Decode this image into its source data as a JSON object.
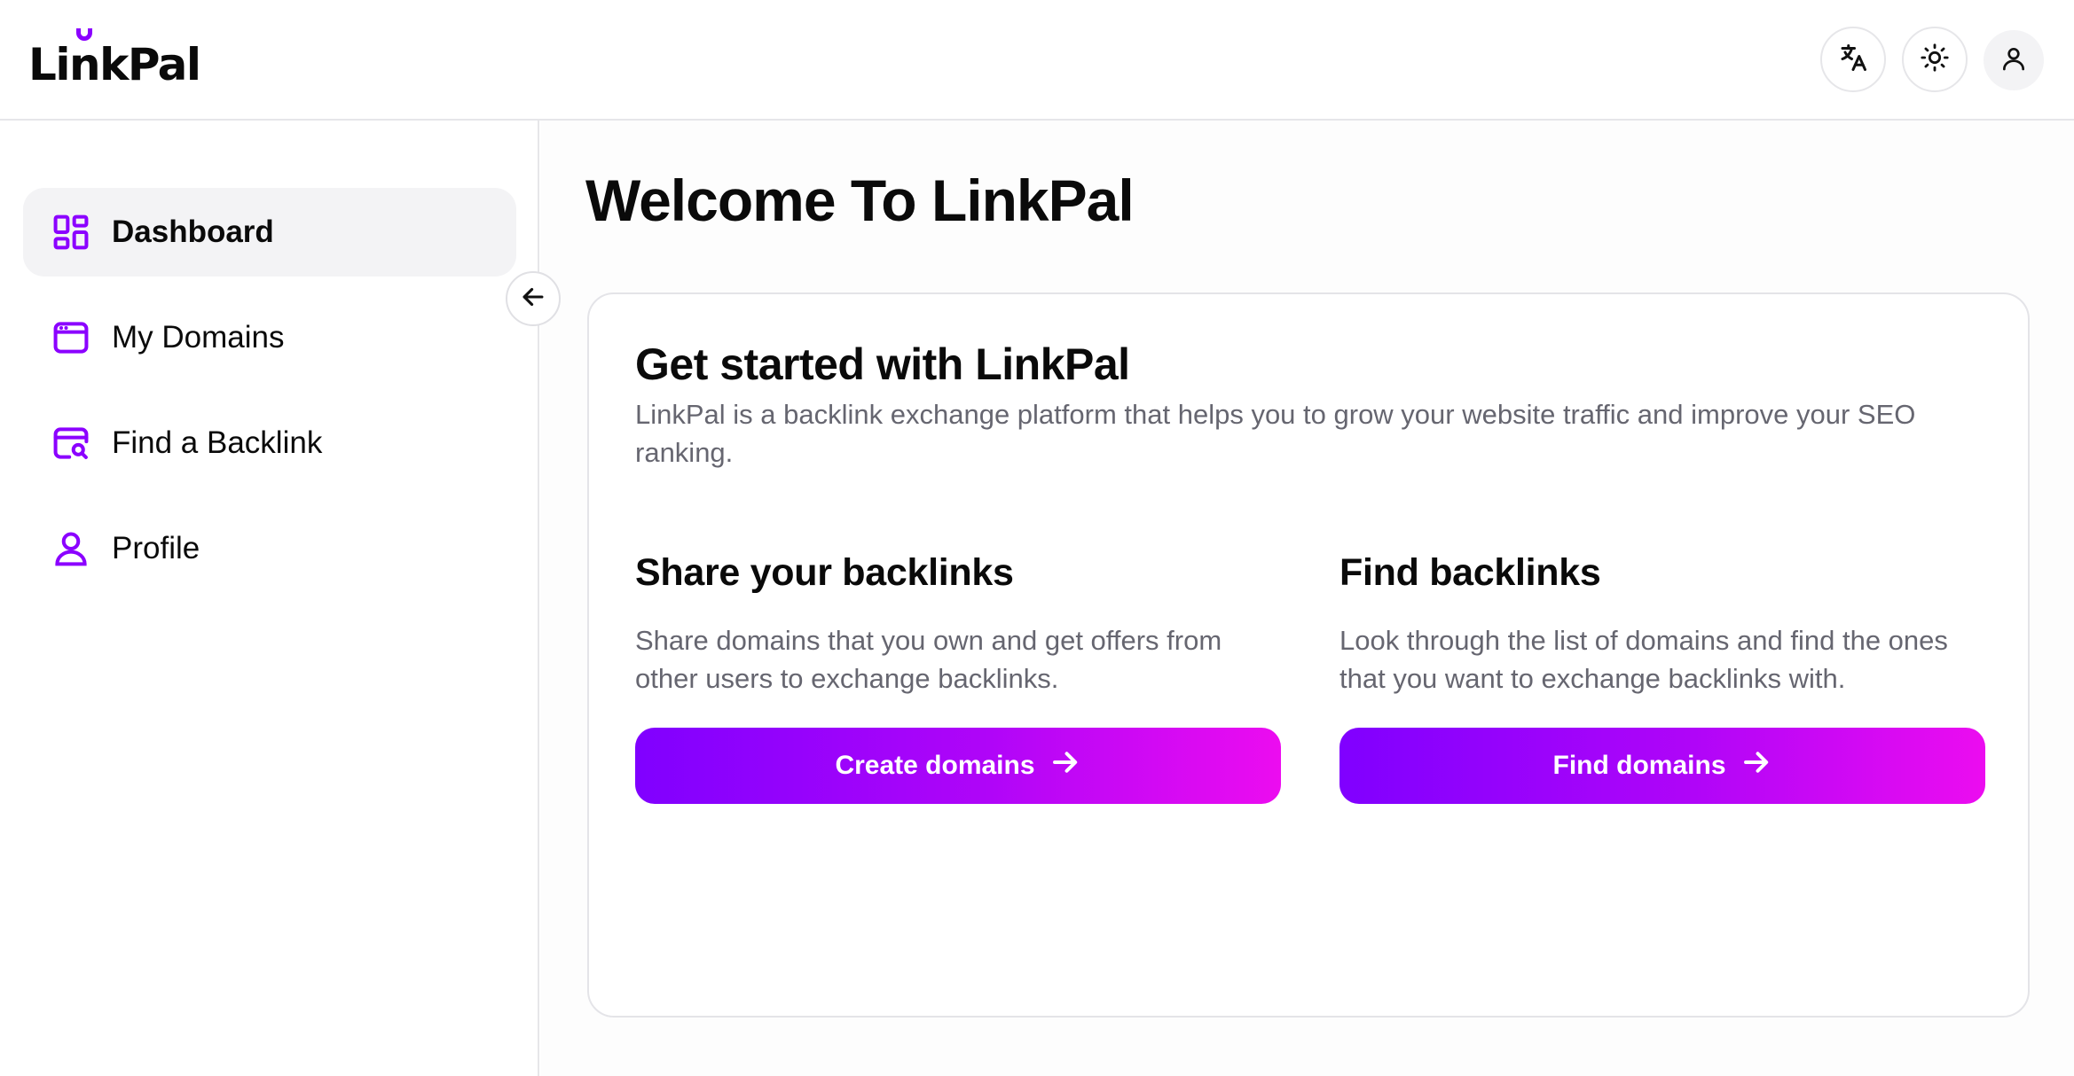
{
  "app": {
    "logo_text_pre": "Li",
    "logo_text_i": "n",
    "logo_text_post": "kPal"
  },
  "header": {
    "buttons": [
      {
        "name": "translate",
        "icon": "translate-icon"
      },
      {
        "name": "theme",
        "icon": "sun-icon"
      },
      {
        "name": "account",
        "icon": "user-icon"
      }
    ]
  },
  "sidebar": {
    "items": [
      {
        "label": "Dashboard",
        "icon": "dashboard-icon",
        "active": true
      },
      {
        "label": "My Domains",
        "icon": "browser-window-icon",
        "active": false
      },
      {
        "label": "Find a Backlink",
        "icon": "window-search-icon",
        "active": false
      },
      {
        "label": "Profile",
        "icon": "user-icon",
        "active": false
      }
    ],
    "collapse_icon": "arrow-left-icon"
  },
  "main": {
    "title": "Welcome To LinkPal",
    "card": {
      "title": "Get started with LinkPal",
      "description": "LinkPal is a backlink exchange platform that helps you to grow your website traffic and improve your SEO ranking.",
      "sections": [
        {
          "heading": "Share your backlinks",
          "text": "Share domains that you own and get offers from other users to exchange backlinks.",
          "button": "Create domains"
        },
        {
          "heading": "Find backlinks",
          "text": "Look through the list of domains and find the ones that you want to exchange backlinks with.",
          "button": "Find domains"
        }
      ]
    }
  },
  "colors": {
    "accent": "#8b00ff",
    "gradient_start": "#8000ff",
    "gradient_end": "#ec0cf0",
    "muted_text": "#666670"
  }
}
